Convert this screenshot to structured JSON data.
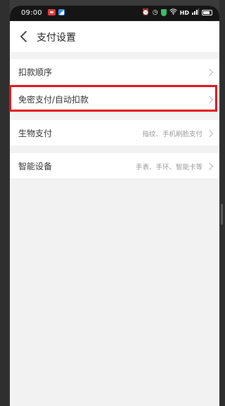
{
  "status_bar": {
    "time": "09:00",
    "left_icons": [
      "notification-red-icon",
      "notification-blue-icon"
    ],
    "right_icons": [
      "alarm-icon",
      "clock-icon",
      "shield-icon",
      "wifi-icon",
      "hd-icon",
      "signal-icon",
      "battery-icon"
    ],
    "hd_text": "HD"
  },
  "header": {
    "back_icon": "back-arrow-icon",
    "title": "支付设置"
  },
  "items": [
    {
      "label": "扣款顺序",
      "sub": ""
    },
    {
      "label": "免密支付/自动扣款",
      "sub": ""
    },
    {
      "label": "生物支付",
      "sub": "指纹、手机刷脸支付"
    },
    {
      "label": "智能设备",
      "sub": "手表、手环、智能卡等"
    }
  ],
  "colors": {
    "highlight": "#e5161b",
    "background": "#f2f2f2",
    "surface": "#ffffff"
  }
}
